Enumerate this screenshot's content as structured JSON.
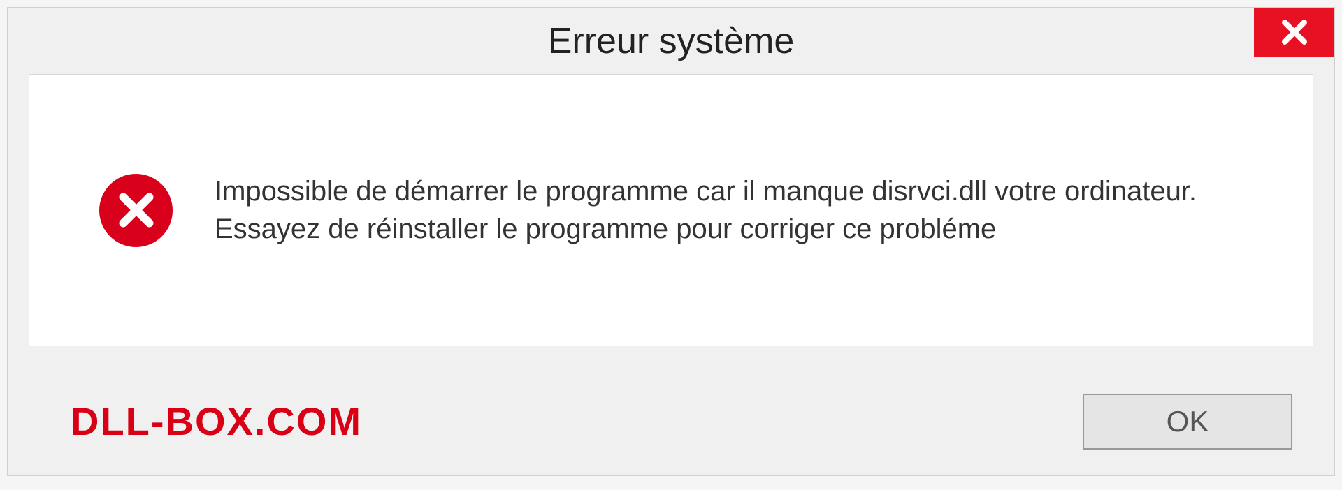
{
  "dialog": {
    "title": "Erreur système",
    "message": "Impossible de démarrer le programme car il manque disrvci.dll votre ordinateur. Essayez de réinstaller le programme pour corriger ce probléme",
    "ok_label": "OK",
    "watermark": "DLL-BOX.COM"
  }
}
